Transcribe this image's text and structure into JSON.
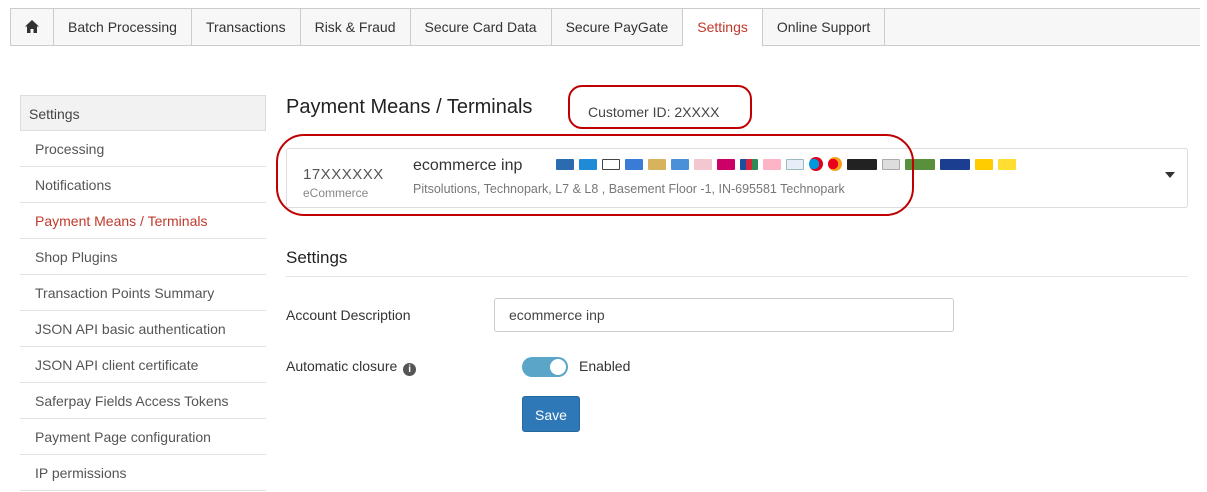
{
  "nav": {
    "home_icon": "home-icon",
    "tabs": [
      {
        "label": "Batch Processing"
      },
      {
        "label": "Transactions"
      },
      {
        "label": "Risk & Fraud"
      },
      {
        "label": "Secure Card Data"
      },
      {
        "label": "Secure PayGate"
      },
      {
        "label": "Settings",
        "active": true
      },
      {
        "label": "Online Support"
      }
    ]
  },
  "sidebar": {
    "heading": "Settings",
    "items": [
      {
        "label": "Processing"
      },
      {
        "label": "Notifications"
      },
      {
        "label": "Payment Means / Terminals",
        "active": true
      },
      {
        "label": "Shop Plugins"
      },
      {
        "label": "Transaction Points Summary"
      },
      {
        "label": "JSON API basic authentication"
      },
      {
        "label": "JSON API client certificate"
      },
      {
        "label": "Saferpay Fields Access Tokens"
      },
      {
        "label": "Payment Page configuration"
      },
      {
        "label": "IP permissions"
      }
    ]
  },
  "main": {
    "title": "Payment Means / Terminals",
    "customer_id": "Customer ID: 2XXXX",
    "terminal": {
      "number": "17XXXXXX",
      "type": "eCommerce",
      "name": "ecommerce inp",
      "address": "Pitsolutions, Technopark, L7 & L8 , Basement Floor -1, IN-695581 Technopark"
    },
    "payment_logos": [
      "card-logo-blue",
      "card-logo-blue",
      "applepay-logo",
      "card-logo-blue",
      "card-logo-gold",
      "card-logo-blue",
      "card-logo-red",
      "ideal-logo",
      "jcb-logo",
      "klarna-logo",
      "card-logo-blue",
      "maestro-logo",
      "mastercard-logo",
      "card-logo-dark",
      "card-logo-grey",
      "paydirekt-logo",
      "paypal-logo",
      "postfinance-logo",
      "postfinance-logo"
    ],
    "colors": {
      "accent": "#c0392b",
      "annotation": "#c00000",
      "button": "#2e78b8",
      "toggle": "#5aa5c8"
    },
    "settings_title": "Settings",
    "account_description_label": "Account Description",
    "account_description_value": "ecommerce inp",
    "auto_closure_label": "Automatic closure",
    "auto_closure_state": "Enabled",
    "save_label": "Save"
  }
}
